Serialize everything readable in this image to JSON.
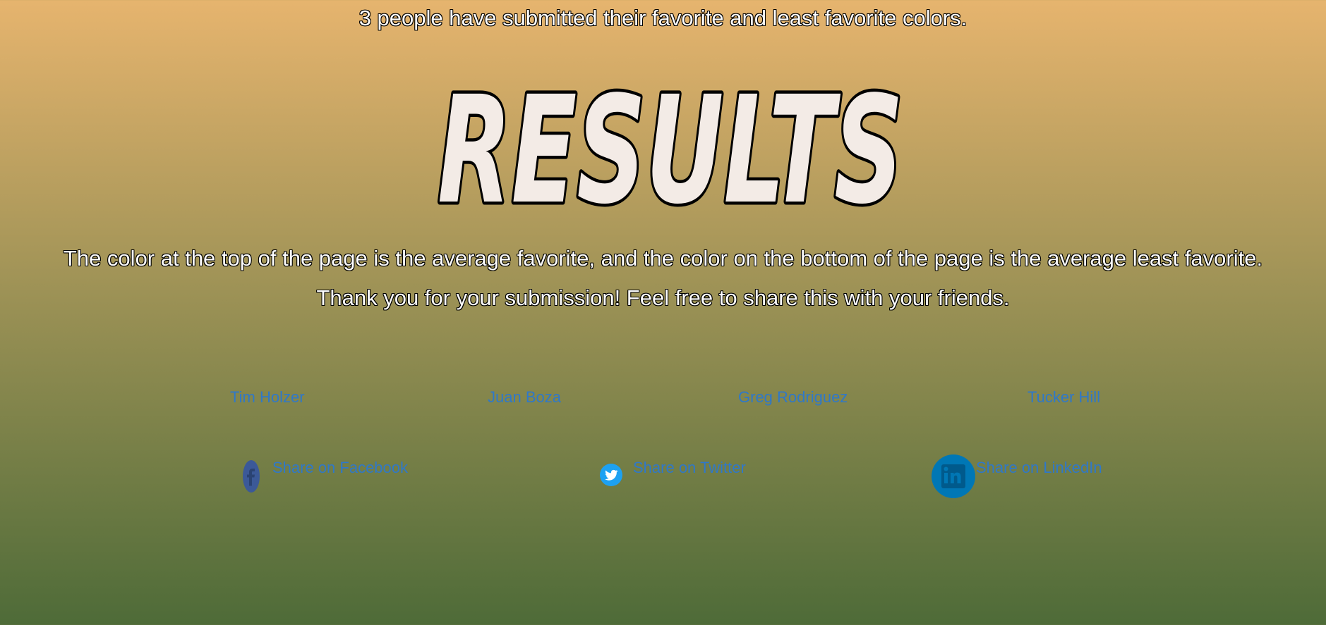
{
  "header": {
    "count_text": "3 people have submitted their favorite and least favorite colors."
  },
  "title": {
    "text": "RESULTS",
    "fill_color": "#f3ebe6",
    "stroke_color": "#000000"
  },
  "description": {
    "line1": "The color at the top of the page is the average favorite, and the color on the bottom of the page is the average least favorite.",
    "line2": "Thank you for your submission! Feel free to share this with your friends."
  },
  "colors": {
    "average_favorite": "#e6b46e",
    "average_least_favorite": "#4e6b38",
    "link": "#2f78c9"
  },
  "credits": [
    {
      "name": "Tim Holzer"
    },
    {
      "name": "Juan Boza"
    },
    {
      "name": "Greg Rodriguez"
    },
    {
      "name": "Tucker Hill"
    }
  ],
  "share": {
    "facebook": {
      "label": "Share on Facebook",
      "icon": "facebook-icon",
      "icon_color": "#3b5998"
    },
    "twitter": {
      "label": "Share on Twitter",
      "icon": "twitter-icon",
      "icon_color": "#1da1f2"
    },
    "linkedin": {
      "label": "Share on LinkedIn",
      "icon": "linkedin-icon",
      "icon_color": "#0077b5"
    }
  }
}
